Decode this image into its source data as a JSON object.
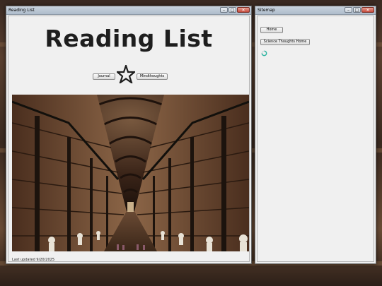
{
  "reading_window": {
    "title": "Reading List",
    "heading": "Reading List",
    "journal_label": "Journal",
    "mindthoughts_label": "Mindthoughts",
    "footer": "Last updated 9/20/2025"
  },
  "sitemap_window": {
    "title": "Sitemap",
    "home_label": "Home",
    "science_label": "Science Thoughts Home"
  },
  "window_controls": {
    "minimize": "–",
    "maximize": "□",
    "close": "✕"
  }
}
